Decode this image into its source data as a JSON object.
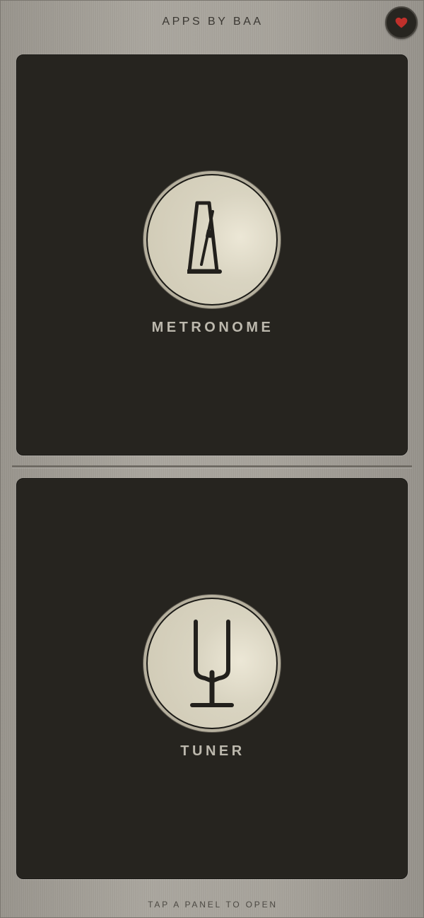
{
  "header": {
    "title": "APPS BY BAA",
    "favorite_icon": "heart-icon",
    "favorite_color": "#c0302b"
  },
  "panels": [
    {
      "id": "metronome",
      "label": "METRONOME",
      "icon": "metronome-icon"
    },
    {
      "id": "tuner",
      "label": "TUNER",
      "icon": "tuning-fork-icon"
    }
  ],
  "footer": {
    "hint": "TAP A PANEL TO OPEN"
  },
  "colors": {
    "background": "#a09c94",
    "panel": "#26241f",
    "dial_face": "#d9d4c1",
    "label_text": "#bcb8ad"
  }
}
